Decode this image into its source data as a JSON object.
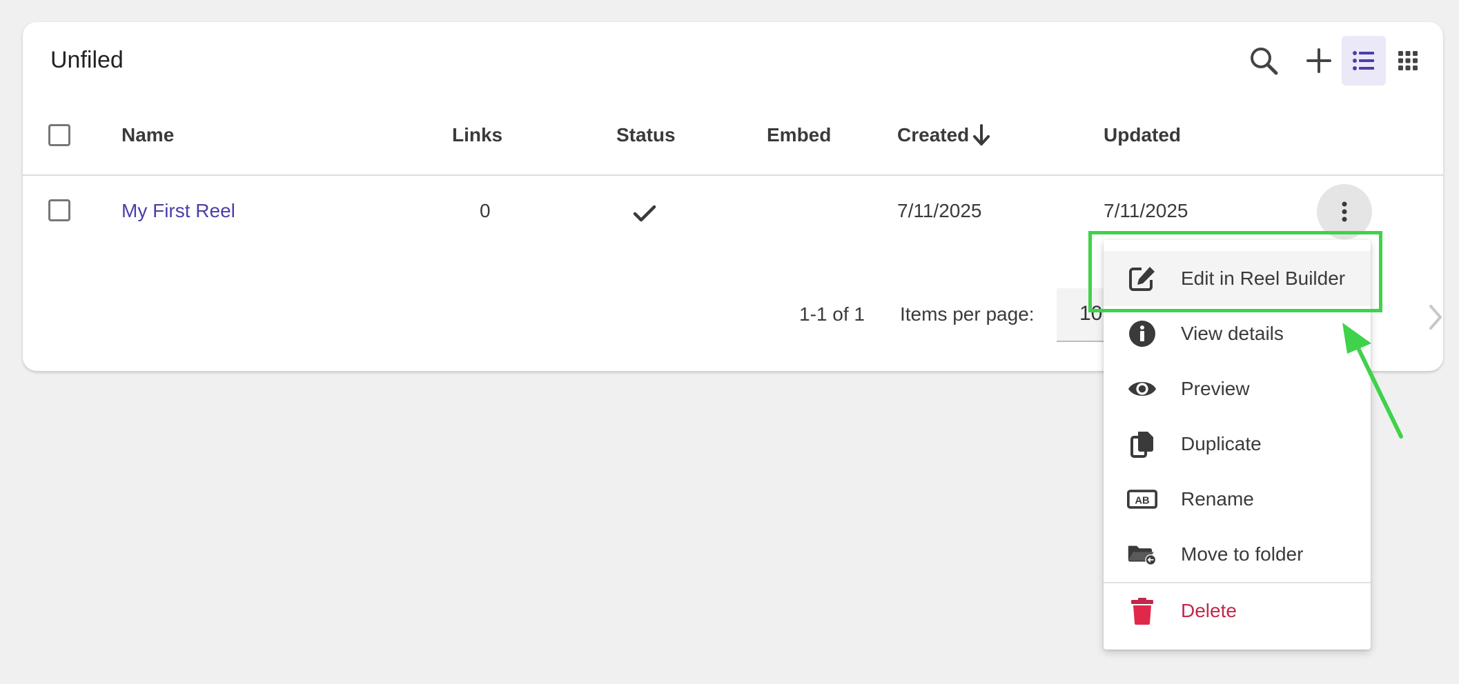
{
  "page": {
    "title": "Unfiled"
  },
  "toolbar": {
    "search_icon": "search-icon",
    "add_icon": "plus-icon",
    "list_view_icon": "list-view-icon",
    "grid_view_icon": "grid-view-icon",
    "active_view": "list"
  },
  "table": {
    "columns": {
      "name": "Name",
      "links": "Links",
      "status": "Status",
      "embed": "Embed",
      "created": "Created",
      "updated": "Updated"
    },
    "sort": {
      "column": "Created",
      "direction": "descending"
    },
    "rows": [
      {
        "name": "My First Reel",
        "links": "0",
        "status": "check",
        "embed": "",
        "created": "7/11/2025",
        "updated": "7/11/2025"
      }
    ]
  },
  "pagination": {
    "range": "1-1 of 1",
    "items_per_page_label": "Items per page:",
    "items_per_page_value": "10"
  },
  "context_menu": {
    "items": [
      {
        "label": "Edit in Reel Builder",
        "icon": "edit-icon"
      },
      {
        "label": "View details",
        "icon": "info-icon"
      },
      {
        "label": "Preview",
        "icon": "eye-icon"
      },
      {
        "label": "Duplicate",
        "icon": "duplicate-icon"
      },
      {
        "label": "Rename",
        "icon": "rename-icon"
      },
      {
        "label": "Move to folder",
        "icon": "move-folder-icon"
      },
      {
        "label": "Delete",
        "icon": "trash-icon"
      }
    ]
  },
  "colors": {
    "accent": "#4a3fa8",
    "danger": "#c2284a",
    "highlight": "#3fd24b",
    "active_view_bg": "#ebe8f8"
  }
}
